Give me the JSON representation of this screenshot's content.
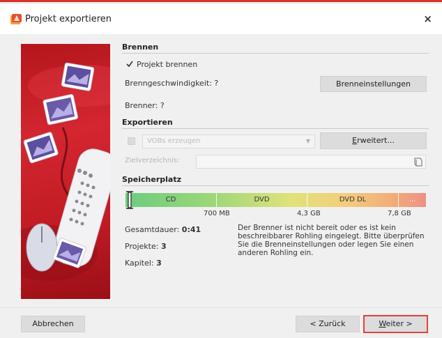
{
  "window": {
    "title": "Projekt exportieren",
    "close_glyph": "×"
  },
  "brennen": {
    "title": "Brennen",
    "checkbox_label": "Projekt brennen",
    "checked": true,
    "speed_label": "Brenngeschwindigkeit: ?",
    "burner_label": "Brenner: ?",
    "settings_button": "Brenneinstellungen"
  },
  "exportieren": {
    "title": "Exportieren",
    "combo_value": "VOBs erzeugen",
    "advanced_button_accel": "E",
    "advanced_button_rest": "rweitert...",
    "target_dir_label": "Zielverzeichnis:"
  },
  "speicher": {
    "title": "Speicherplatz",
    "segments": [
      "CD",
      "DVD",
      "DVD DL",
      "..."
    ],
    "ticks": [
      "700 MB",
      "4,3 GB",
      "7,8 GB"
    ],
    "duration_label": "Gesamtdauer:",
    "duration_value": "0:41",
    "projects_label": "Projekte:",
    "projects_value": "3",
    "chapters_label": "Kapitel:",
    "chapters_value": "3",
    "message": "Der Brenner ist nicht bereit oder es ist kein beschreibbarer Rohling eingelegt. Bitte überprüfen Sie die Brenneinstellungen oder legen Sie einen anderen Rohling ein."
  },
  "footer": {
    "cancel": "Abbrechen",
    "back": "< Zurück",
    "next_accel": "W",
    "next_rest": "eiter >"
  },
  "colors": {
    "accent": "#d9322d",
    "hero": "#c11b24"
  }
}
